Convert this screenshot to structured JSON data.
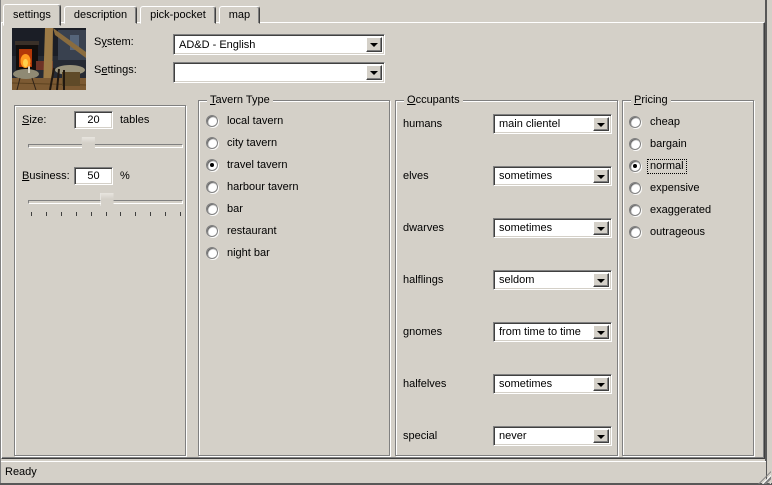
{
  "tabs": {
    "items": [
      {
        "label": "settings",
        "active": true
      },
      {
        "label": "description",
        "active": false
      },
      {
        "label": "pick-pocket",
        "active": false
      },
      {
        "label": "map",
        "active": false
      }
    ]
  },
  "header": {
    "system": {
      "label": {
        "text": "System:",
        "accel": 1
      },
      "value": "AD&D - English"
    },
    "settings": {
      "label": {
        "text": "Settings:",
        "accel": 1
      },
      "value": ""
    }
  },
  "size_panel": {
    "size": {
      "label": {
        "text": "Size:",
        "accel": 0
      },
      "value": "20",
      "unit": "tables",
      "slider_pct": 39
    },
    "business": {
      "label": {
        "text": "Business:",
        "accel": 0
      },
      "value": "50",
      "unit": "%",
      "slider_pct": 51,
      "tick_count": 11
    }
  },
  "tavern_type": {
    "title": {
      "text": "Tavern Type",
      "accel": 0
    },
    "options": [
      {
        "label": "local tavern",
        "selected": false
      },
      {
        "label": "city tavern",
        "selected": false
      },
      {
        "label": "travel tavern",
        "selected": true
      },
      {
        "label": "harbour tavern",
        "selected": false
      },
      {
        "label": "bar",
        "selected": false
      },
      {
        "label": "restaurant",
        "selected": false
      },
      {
        "label": "night bar",
        "selected": false
      }
    ]
  },
  "occupants": {
    "title": {
      "text": "Occupants",
      "accel": 0
    },
    "rows": [
      {
        "label": "humans",
        "value": "main clientel"
      },
      {
        "label": "elves",
        "value": "sometimes"
      },
      {
        "label": "dwarves",
        "value": "sometimes"
      },
      {
        "label": "halflings",
        "value": "seldom"
      },
      {
        "label": "gnomes",
        "value": "from time to time"
      },
      {
        "label": "halfelves",
        "value": "sometimes"
      },
      {
        "label": "special",
        "value": "never"
      }
    ]
  },
  "pricing": {
    "title": {
      "text": "Pricing",
      "accel": 0
    },
    "options": [
      {
        "label": "cheap",
        "selected": false,
        "focused": false
      },
      {
        "label": "bargain",
        "selected": false,
        "focused": false
      },
      {
        "label": "normal",
        "selected": true,
        "focused": true
      },
      {
        "label": "expensive",
        "selected": false,
        "focused": false
      },
      {
        "label": "exaggerated",
        "selected": false,
        "focused": false
      },
      {
        "label": "outrageous",
        "selected": false,
        "focused": false
      }
    ]
  },
  "statusbar": {
    "text": "Ready"
  },
  "colors": {
    "face": "#d4d0c8",
    "highlight": "#ffffff",
    "shadow": "#808080",
    "dark_shadow": "#404040",
    "field": "#ffffff",
    "text": "#000000",
    "fire_accent": "#ff9a1f"
  }
}
